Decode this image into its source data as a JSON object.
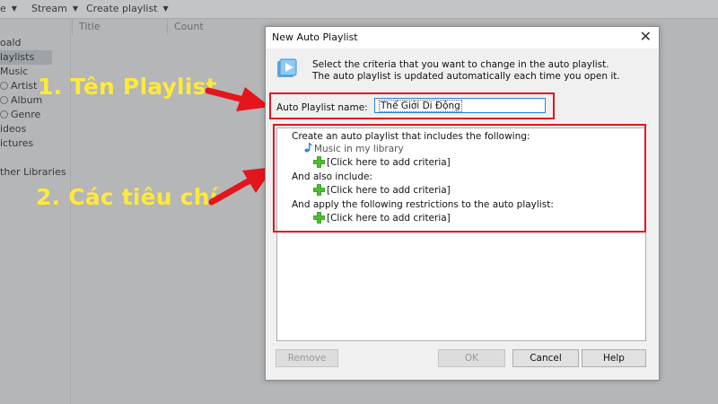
{
  "toolbar": {
    "items": [
      "e",
      "Stream",
      "Create playlist"
    ]
  },
  "columns": [
    "Title",
    "Count"
  ],
  "sidebar": {
    "items": [
      {
        "label": "oald"
      },
      {
        "label": "laylists"
      },
      {
        "label": "Music"
      },
      {
        "label": "Artist"
      },
      {
        "label": "Album"
      },
      {
        "label": "Genre"
      },
      {
        "label": "ideos"
      },
      {
        "label": "ictures"
      },
      {
        "label": "ther Libraries"
      }
    ]
  },
  "annotations": {
    "step1": "1. Tên Playlist",
    "step2": "2. Các tiêu chí"
  },
  "dialog": {
    "title": "New Auto Playlist",
    "close_glyph": "✕",
    "description_line1": "Select the criteria that you want to change in the auto playlist.",
    "description_line2": "The auto playlist is updated automatically each time you open it.",
    "name_label": "Auto Playlist name:",
    "name_value": "Thế Giới Di Động",
    "criteria": {
      "heading1": "Create an auto playlist that includes the following:",
      "music_library": "Music in my library",
      "add_criteria": "[Click here to add criteria]",
      "heading2": "And also include:",
      "heading3": "And apply the following restrictions to the auto playlist:"
    },
    "buttons": {
      "remove": "Remove",
      "ok": "OK",
      "cancel": "Cancel",
      "help": "Help"
    }
  },
  "colors": {
    "highlight": "#e4151d",
    "annotation_text": "#ffe93a",
    "plus_green": "#4cbf2f",
    "note_blue": "#2e8bd8"
  },
  "icons": [
    "playlist-icon",
    "music-note-icon",
    "plus-icon",
    "close-icon",
    "caret-down-icon",
    "arrow-icon"
  ]
}
